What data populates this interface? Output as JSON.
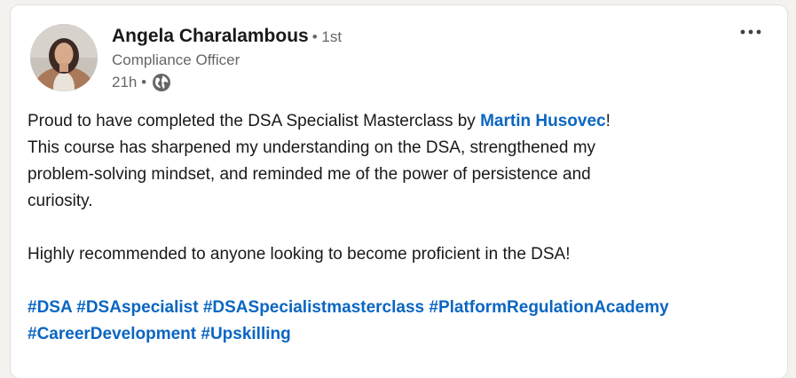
{
  "post": {
    "author": {
      "name": "Angela Charalambous",
      "degree": "• 1st",
      "headline": "Compliance Officer",
      "time": "21h •",
      "visibility_icon": "globe-icon"
    },
    "menu_icon": "more-horizontal-icon",
    "body": {
      "intro_before": "Proud to have completed the DSA Specialist Masterclass by ",
      "mention": "Martin Husovec",
      "intro_after": "!",
      "line2": "This course has sharpened my understanding on the DSA, strengthened my",
      "line3": "problem-solving mindset, and reminded me of the power of persistence and",
      "line4": "curiosity.",
      "recommend": "Highly recommended to anyone looking to become proficient in the DSA!"
    },
    "hashtags": [
      "#DSA",
      "#DSAspecialist",
      "#DSASpecialistmasterclass",
      "#PlatformRegulationAcademy",
      "#CareerDevelopment",
      "#Upskilling"
    ]
  },
  "colors": {
    "link": "#0a66c2",
    "text": "#191919",
    "muted": "#666666",
    "background": "#f4f2ee"
  }
}
